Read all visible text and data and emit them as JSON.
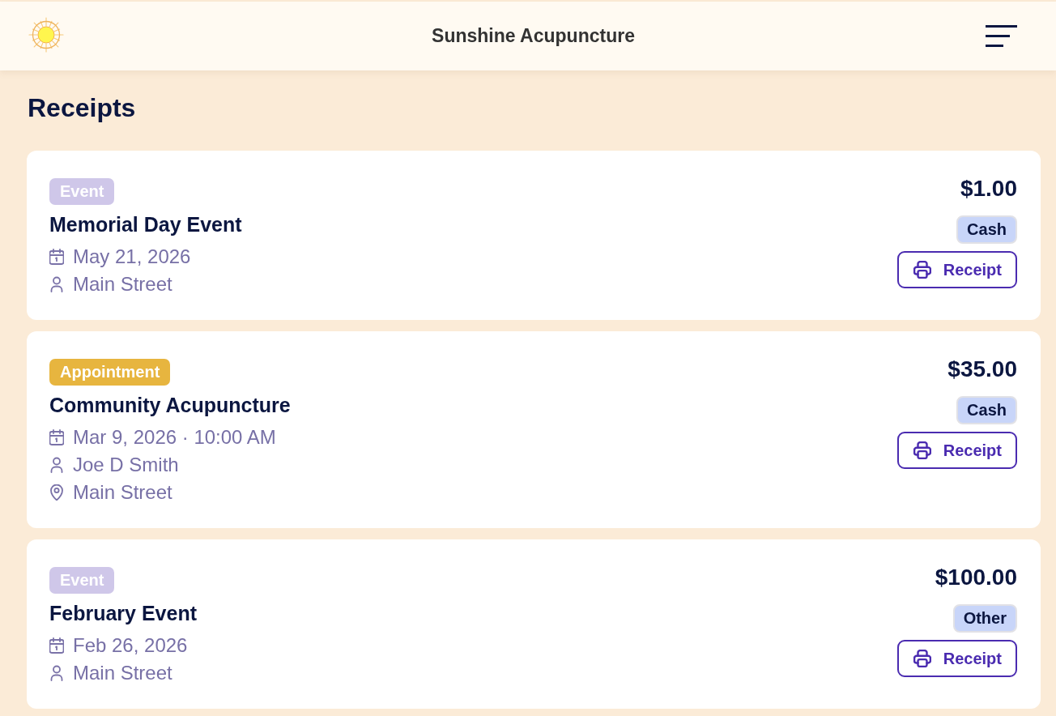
{
  "header": {
    "title": "Sunshine Acupuncture"
  },
  "page": {
    "title": "Receipts"
  },
  "receipts": [
    {
      "category": {
        "label": "Event",
        "color": "#cfc7e9"
      },
      "title": "Memorial Day Event",
      "details": [
        {
          "kind": "date",
          "text": "May 21, 2026"
        },
        {
          "kind": "person",
          "text": "Main Street"
        }
      ],
      "amount": "$1.00",
      "payment_method": "Cash",
      "button": "Receipt"
    },
    {
      "category": {
        "label": "Appointment",
        "color": "#e7b53f"
      },
      "title": "Community Acupuncture",
      "details": [
        {
          "kind": "date",
          "text": "Mar 9, 2026 · 10:00 AM"
        },
        {
          "kind": "person",
          "text": "Joe D Smith"
        },
        {
          "kind": "location",
          "text": "Main Street"
        }
      ],
      "amount": "$35.00",
      "payment_method": "Cash",
      "button": "Receipt"
    },
    {
      "category": {
        "label": "Event",
        "color": "#cfc7e9"
      },
      "title": "February Event",
      "details": [
        {
          "kind": "date",
          "text": "Feb 26, 2026"
        },
        {
          "kind": "person",
          "text": "Main Street"
        }
      ],
      "amount": "$100.00",
      "payment_method": "Other",
      "button": "Receipt"
    }
  ]
}
